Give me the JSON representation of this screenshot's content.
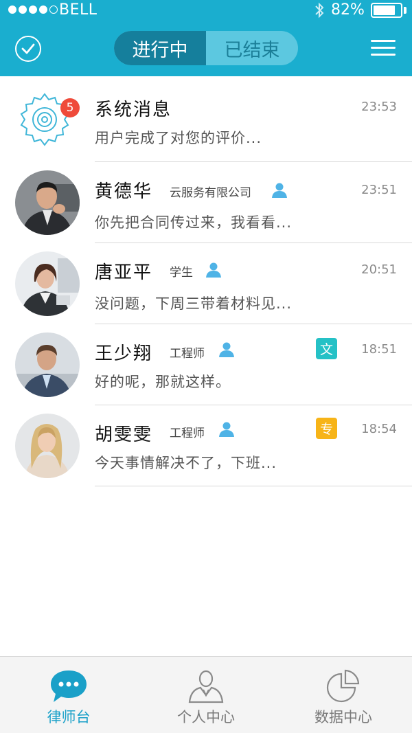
{
  "status_bar": {
    "carrier": "BELL",
    "battery_text": "82%",
    "battery_level": 0.82
  },
  "header": {
    "segments": [
      {
        "label": "进行中",
        "active": true
      },
      {
        "label": "已结束",
        "active": false
      }
    ],
    "check_icon": "check-circle-icon",
    "menu_icon": "hamburger-menu-icon"
  },
  "messages": [
    {
      "name": "系统消息",
      "role": "",
      "message": "用户完成了对您的评价...",
      "time": "23:53",
      "badge": "5",
      "tag": "",
      "avatar": "gear-icon"
    },
    {
      "name": "黄德华",
      "role": "云服务有限公司",
      "message": "你先把合同传过来，我看看...",
      "time": "23:51",
      "tag": "",
      "avatar": "avatar-man-suit"
    },
    {
      "name": "唐亚平",
      "role": "学生",
      "message": "没问题，下周三带着材料见...",
      "time": "20:51",
      "tag": "",
      "avatar": "avatar-woman-office"
    },
    {
      "name": "王少翔",
      "role": "工程师",
      "message": "好的呢，那就这样。",
      "time": "18:51",
      "tag": "文",
      "tag_color": "#25c1c6",
      "avatar": "avatar-man-desk"
    },
    {
      "name": "胡雯雯",
      "role": "工程师",
      "message": "今天事情解决不了，下班...",
      "time": "18:54",
      "tag": "专",
      "tag_color": "#f7b418",
      "avatar": "avatar-woman-blonde"
    }
  ],
  "tabbar": {
    "tabs": [
      {
        "label": "律师台",
        "icon": "chat-bubble-icon",
        "active": true
      },
      {
        "label": "个人中心",
        "icon": "person-icon",
        "active": false
      },
      {
        "label": "数据中心",
        "icon": "pie-chart-icon",
        "active": false
      }
    ]
  },
  "colors": {
    "primary": "#1aaecf",
    "active_tab": "#1aa0c8",
    "badge": "#ef4a3a"
  }
}
